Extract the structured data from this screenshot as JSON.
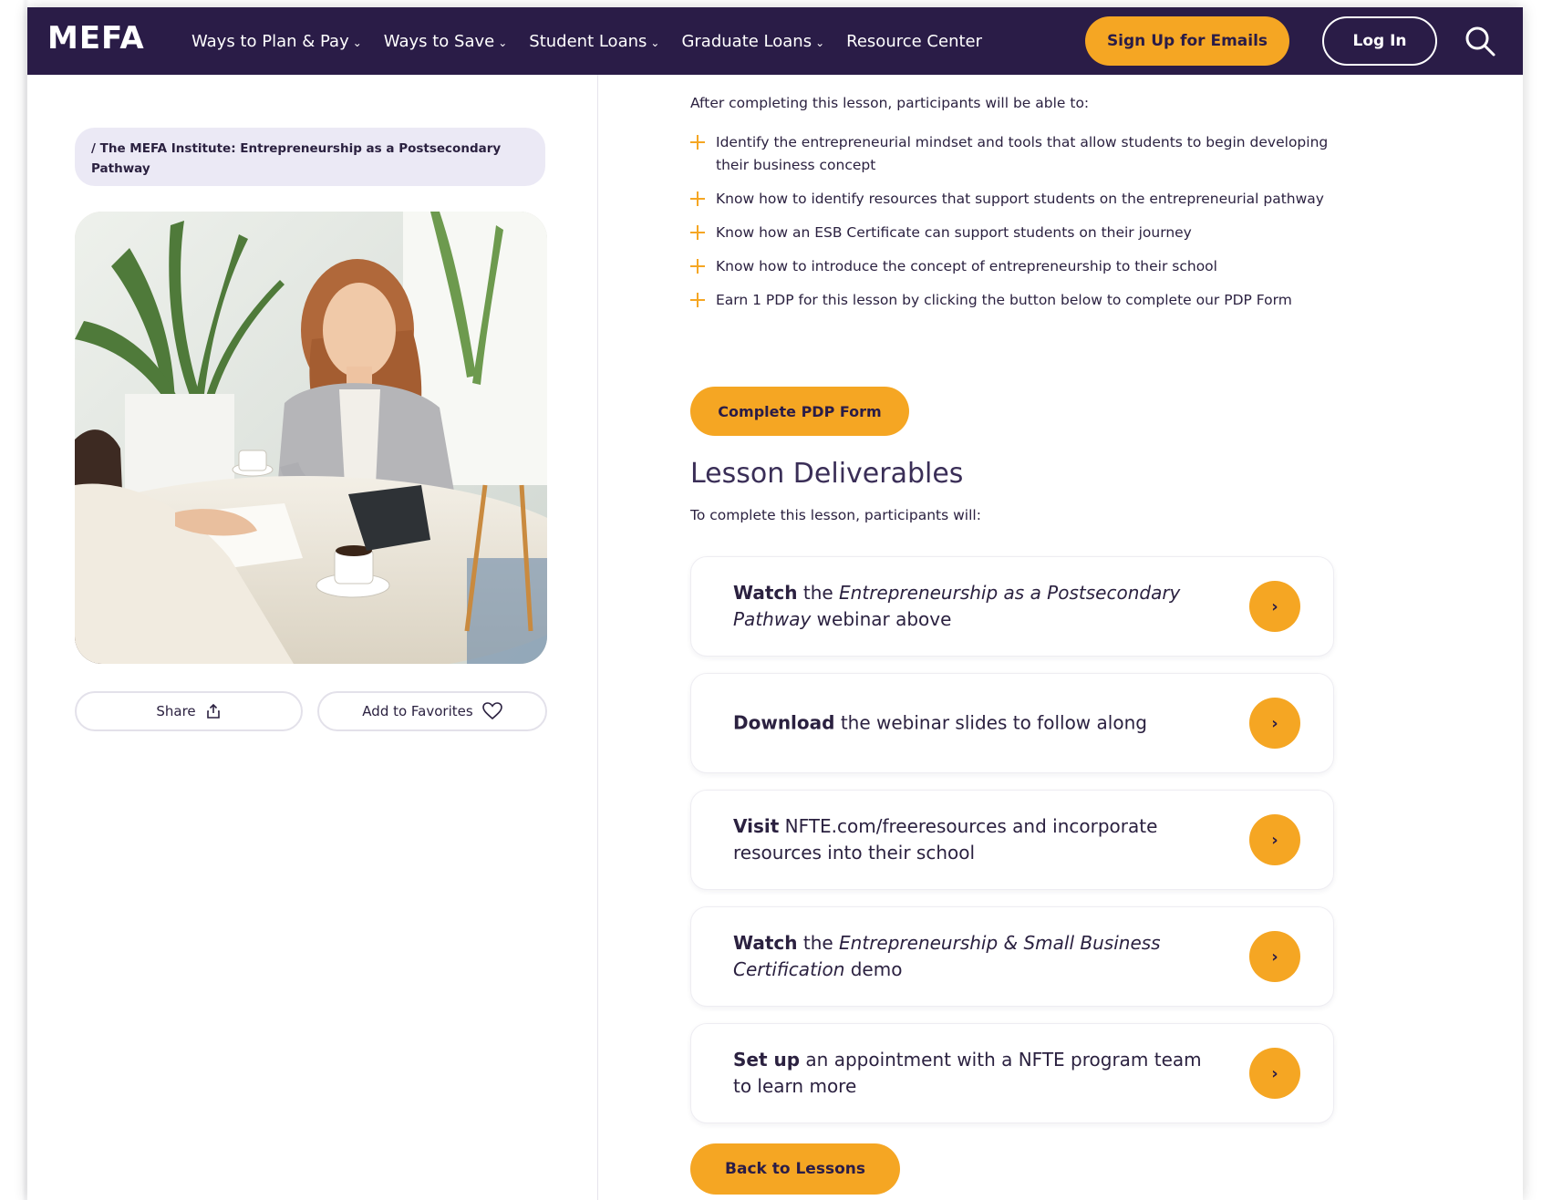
{
  "nav": {
    "logo": "MEFA",
    "links": [
      {
        "label": "Ways to Plan & Pay",
        "dropdown": true
      },
      {
        "label": "Ways to Save",
        "dropdown": true
      },
      {
        "label": "Student Loans",
        "dropdown": true
      },
      {
        "label": "Graduate Loans",
        "dropdown": true
      },
      {
        "label": "Resource Center",
        "dropdown": false
      }
    ],
    "signup_label": "Sign Up for Emails",
    "login_label": "Log In",
    "search_icon": "search-icon"
  },
  "left": {
    "breadcrumb": "/ The MEFA Institute: Entrepreneurship as a Postsecondary Pathway",
    "hero_alt": "hero-photo",
    "share_label": "Share",
    "favorites_label": "Add to Favorites"
  },
  "objectives": {
    "intro": "After completing this lesson, participants will be able to:",
    "items": [
      "Identify the entrepreneurial mindset and tools that allow students to begin developing their business concept",
      "Know how to identify resources that support students on the entrepreneurial pathway",
      "Know how an ESB Certificate can support students on their journey",
      "Know how to introduce the concept of entrepreneurship to their school",
      "Earn 1 PDP for this lesson by clicking the button below to complete our PDP Form"
    ],
    "pdp_button": "Complete PDP Form"
  },
  "deliverables": {
    "title": "Lesson Deliverables",
    "intro": "To complete this lesson, participants will:",
    "cards": [
      {
        "bold": "Watch",
        "pre": " the ",
        "italic": "Entrepreneurship as a Postsecondary Pathway",
        "post": " webinar above"
      },
      {
        "bold": "Download",
        "pre": " the webinar slides to follow along",
        "italic": "",
        "post": ""
      },
      {
        "bold": "Visit",
        "pre": " NFTE.com/freeresources and incorporate resources into their school",
        "italic": "",
        "post": ""
      },
      {
        "bold": "Watch",
        "pre": " the ",
        "italic": "Entrepreneurship & Small Business Certification",
        "post": " demo"
      },
      {
        "bold": "Set up",
        "pre": " an appointment with a NFTE program team to learn more",
        "italic": "",
        "post": ""
      }
    ],
    "arrow_glyph": "›"
  },
  "back_button": "Back to Lessons",
  "colors": {
    "nav_bg": "#2a1c47",
    "accent": "#f5a623",
    "text": "#2b2140"
  }
}
